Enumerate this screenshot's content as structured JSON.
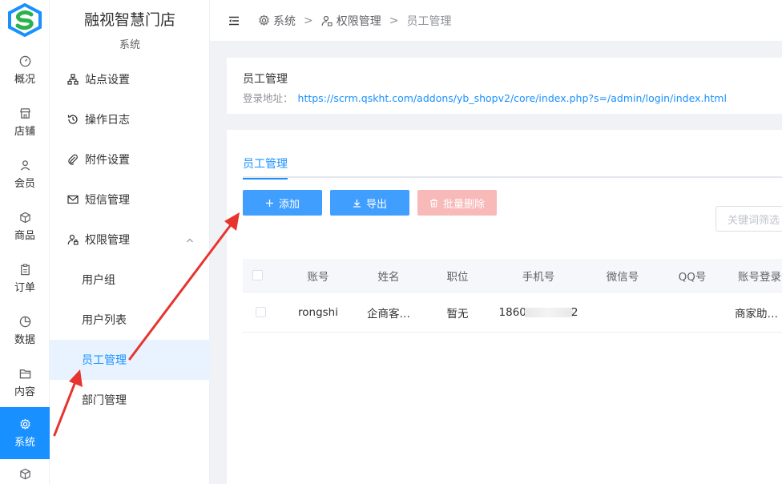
{
  "colors": {
    "accent": "#1890ff",
    "danger_light": "#f8b9b9",
    "arrow": "#e8342f",
    "logo_green": "#2bb24c",
    "logo_blue": "#1890ff"
  },
  "rail": {
    "items": [
      {
        "label": "概况",
        "icon": "dashboard-icon"
      },
      {
        "label": "店铺",
        "icon": "shop-icon"
      },
      {
        "label": "会员",
        "icon": "user-icon"
      },
      {
        "label": "商品",
        "icon": "box-icon"
      },
      {
        "label": "订单",
        "icon": "clipboard-icon"
      },
      {
        "label": "数据",
        "icon": "pie-chart-icon"
      },
      {
        "label": "内容",
        "icon": "folder-icon"
      },
      {
        "label": "系统",
        "icon": "gear-icon"
      }
    ]
  },
  "sidebar": {
    "brand": "融视智慧门店",
    "section": "系统",
    "items": [
      {
        "label": "站点设置",
        "icon": "sitemap-icon"
      },
      {
        "label": "操作日志",
        "icon": "history-icon"
      },
      {
        "label": "附件设置",
        "icon": "paperclip-icon"
      },
      {
        "label": "短信管理",
        "icon": "mail-icon"
      },
      {
        "label": "权限管理",
        "icon": "user-lock-icon"
      }
    ],
    "subitems": [
      {
        "label": "用户组"
      },
      {
        "label": "用户列表"
      },
      {
        "label": "员工管理"
      },
      {
        "label": "部门管理"
      }
    ]
  },
  "breadcrumb": {
    "items": [
      "系统",
      "权限管理",
      "员工管理"
    ],
    "separator": ">"
  },
  "info": {
    "title": "员工管理",
    "address_label": "登录地址：",
    "address_url": "https://scrm.qskht.com/addons/yb_shopv2/core/index.php?s=/admin/login/index.html"
  },
  "tabs": {
    "active": "员工管理"
  },
  "toolbar": {
    "add_label": "添加",
    "export_label": "导出",
    "bulk_delete_label": "批量删除",
    "search_placeholder": "关键词筛选"
  },
  "table": {
    "columns": [
      "账号",
      "姓名",
      "职位",
      "手机号",
      "微信号",
      "QQ号",
      "账号登录"
    ],
    "rows": [
      {
        "account": "rongshi",
        "name": "企商客…",
        "position": "暂无",
        "phone_prefix": "1860",
        "phone_suffix": "2",
        "wechat": "",
        "qq": "",
        "login": "商家助…"
      }
    ]
  }
}
